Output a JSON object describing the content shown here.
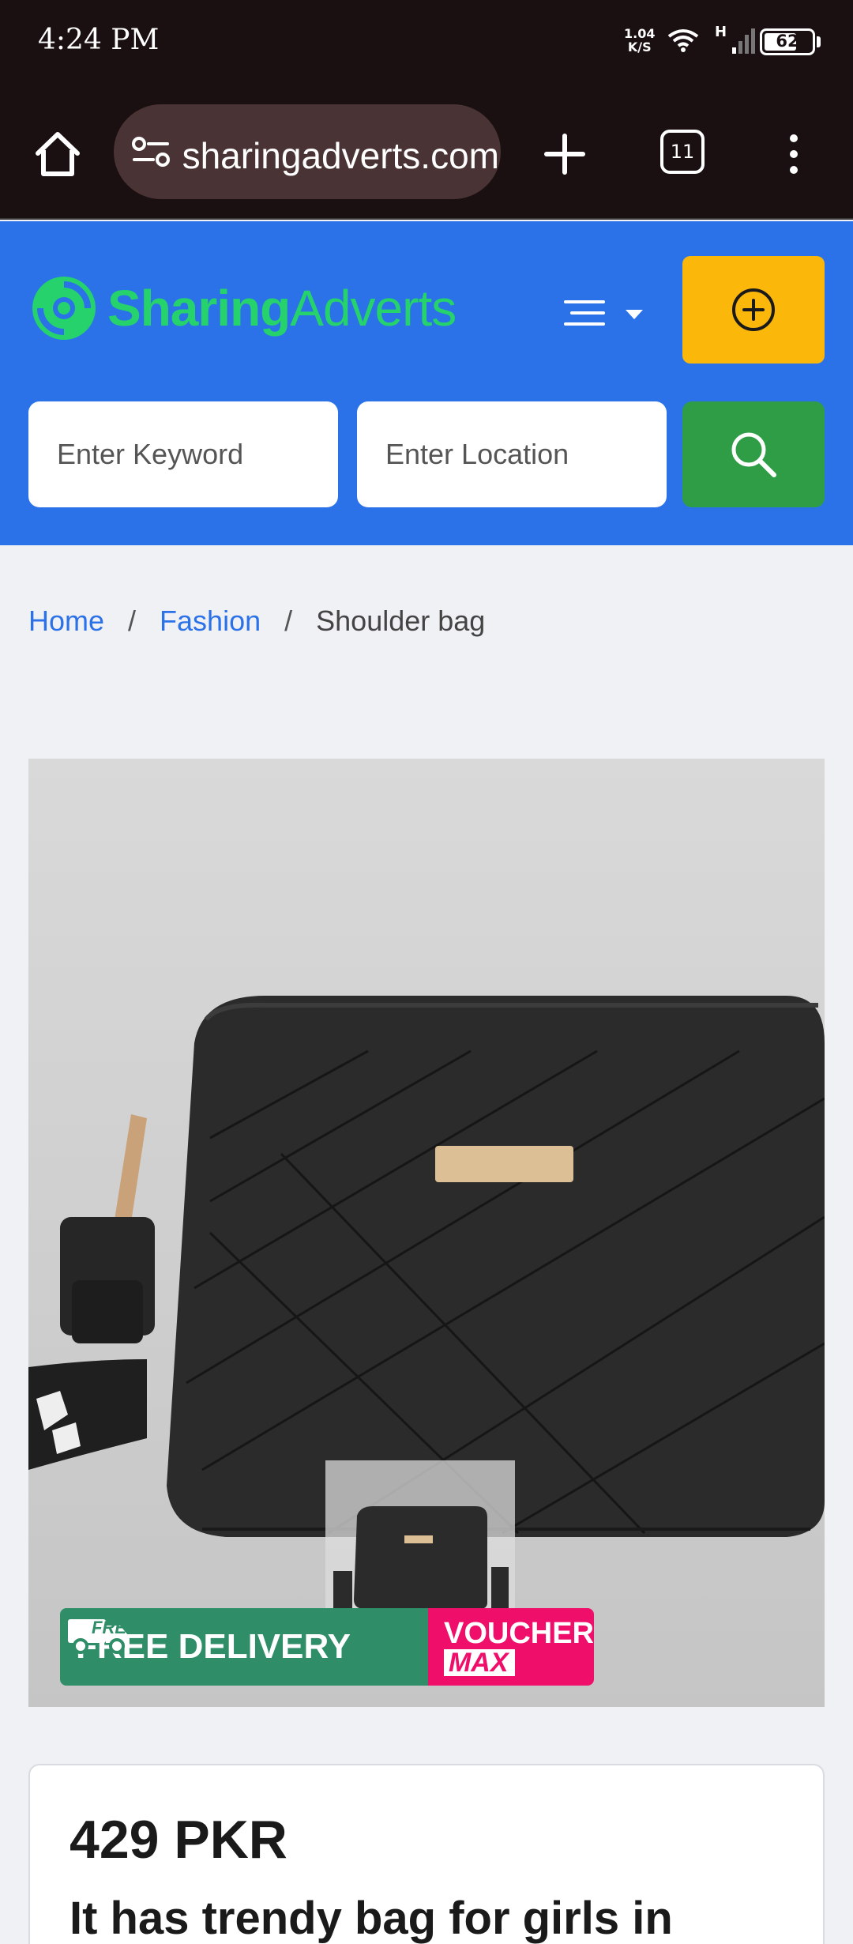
{
  "status_bar": {
    "time": "4:24 PM",
    "net_speed_value": "1.04",
    "net_speed_unit": "K/S",
    "network_type": "H",
    "battery_level": "62"
  },
  "browser": {
    "url": "sharingadverts.com",
    "tab_count": "11"
  },
  "header": {
    "logo_part1": "Sharing",
    "logo_part2": "Adverts",
    "brand_color": "#25d26b",
    "accent_color": "#2b72e8",
    "post_ad_color": "#fcb70b",
    "search_color": "#2e9d46"
  },
  "search": {
    "keyword_placeholder": "Enter Keyword",
    "location_placeholder": "Enter Location"
  },
  "breadcrumb": {
    "items": [
      "Home",
      "Fashion",
      "Shoulder bag"
    ],
    "separator": "/"
  },
  "product_image": {
    "banner_free": "FREE",
    "banner_delivery": "FREE DELIVERY",
    "banner_voucher": "VOUCHER",
    "banner_max": "MAX"
  },
  "listing": {
    "price": "429 PKR",
    "title": "It has trendy bag for girls in"
  }
}
